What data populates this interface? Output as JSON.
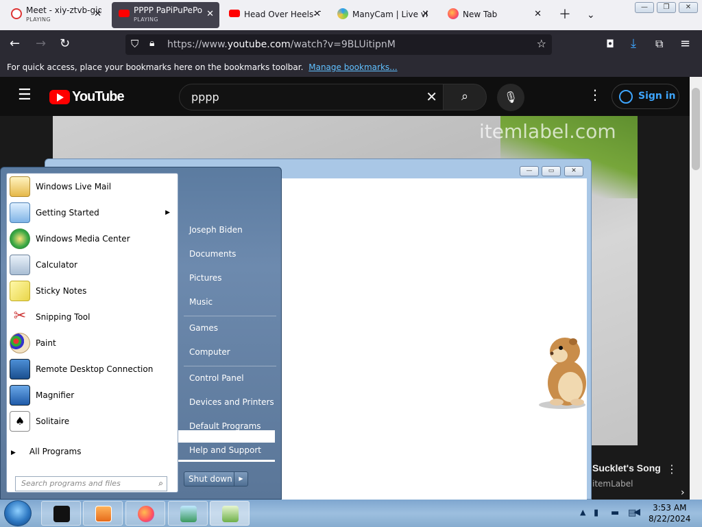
{
  "browser": {
    "tabs": [
      {
        "title": "Meet - xiy-ztvb-giq",
        "status": "PLAYING",
        "icon": "meet-icon",
        "active": false
      },
      {
        "title": "PPPP PaPiPuPePo",
        "status": "PLAYING",
        "icon": "youtube-icon",
        "active": true
      },
      {
        "title": "Head Over Heels- T",
        "status": "",
        "icon": "youtube-icon",
        "active": false
      },
      {
        "title": "ManyCam | Live vi",
        "status": "",
        "icon": "manycam-icon",
        "active": false
      },
      {
        "title": "New Tab",
        "status": "",
        "icon": "firefox-icon",
        "active": false
      }
    ],
    "url_prefix": "https://www.",
    "url_domain": "youtube.com",
    "url_path": "/watch?v=9BLUitipnM",
    "bookmarks_message": "For quick access, place your bookmarks here on the bookmarks toolbar.",
    "bookmarks_link": "Manage bookmarks..."
  },
  "youtube": {
    "logo_text": "YouTube",
    "search_query": "pppp",
    "sign_in": "Sign in",
    "watermark": "itemlabel.com",
    "next_title": "Sucklet's Song",
    "next_channel": "itemLabel"
  },
  "start_menu": {
    "programs": [
      {
        "label": "Windows Live Mail",
        "icon": "mail-icon",
        "submenu": false
      },
      {
        "label": "Getting Started",
        "icon": "getting-started-icon",
        "submenu": true
      },
      {
        "label": "Windows Media Center",
        "icon": "media-center-icon",
        "submenu": false
      },
      {
        "label": "Calculator",
        "icon": "calculator-icon",
        "submenu": false
      },
      {
        "label": "Sticky Notes",
        "icon": "sticky-notes-icon",
        "submenu": false
      },
      {
        "label": "Snipping Tool",
        "icon": "scissors-icon",
        "submenu": false
      },
      {
        "label": "Paint",
        "icon": "paint-icon",
        "submenu": false
      },
      {
        "label": "Remote Desktop Connection",
        "icon": "remote-desktop-icon",
        "submenu": false
      },
      {
        "label": "Magnifier",
        "icon": "magnifier-icon",
        "submenu": false
      },
      {
        "label": "Solitaire",
        "icon": "solitaire-icon",
        "submenu": false
      }
    ],
    "all_programs": "All Programs",
    "search_placeholder": "Search programs and files",
    "places": [
      "Joseph Biden",
      "Documents",
      "Pictures",
      "Music",
      "Games",
      "Computer",
      "Control Panel",
      "Devices and Printers",
      "Default Programs",
      "Help and Support"
    ],
    "shutdown": "Shut down"
  },
  "taskbar": {
    "time": "3:53 AM",
    "date": "8/22/2024"
  },
  "colors": {
    "youtube_red": "#ff0000",
    "link_blue": "#3ea6ff",
    "firefox_dark": "#2b2a33"
  }
}
